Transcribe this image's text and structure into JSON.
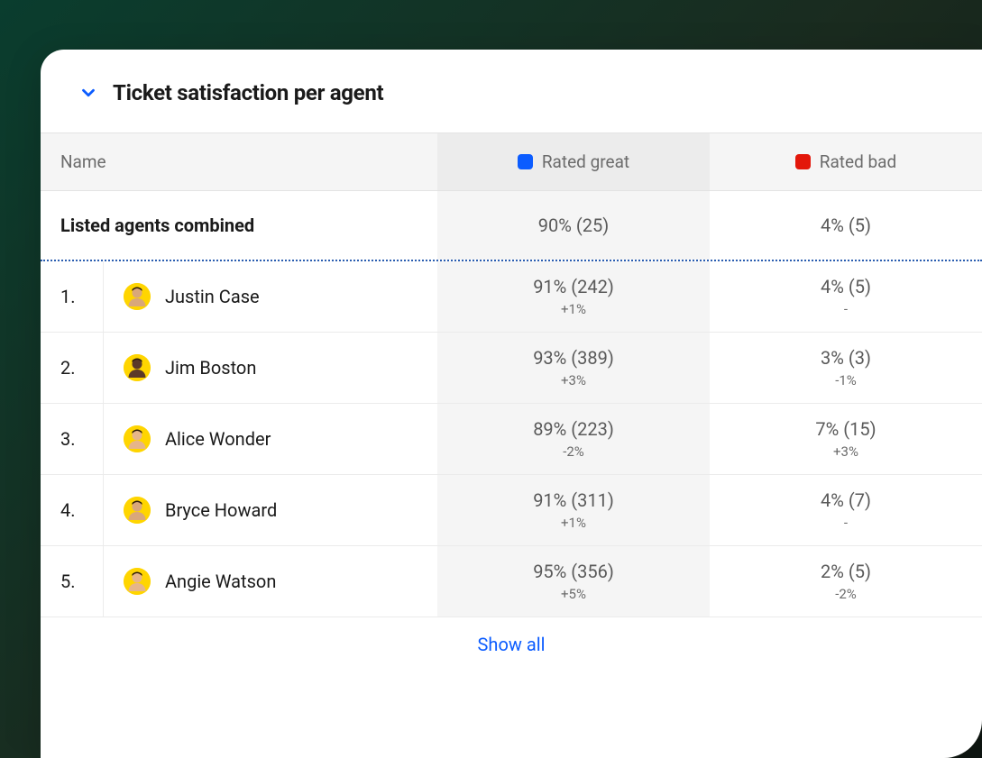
{
  "header": {
    "title": "Ticket satisfaction per agent"
  },
  "columns": {
    "name": "Name",
    "great": "Rated great",
    "bad": "Rated bad"
  },
  "combined": {
    "label": "Listed agents combined",
    "great": "90% (25)",
    "bad": "4% (5)"
  },
  "agents": [
    {
      "rank": "1.",
      "name": "Justin Case",
      "great_main": "91% (242)",
      "great_delta": "+1%",
      "bad_main": "4% (5)",
      "bad_delta": "-"
    },
    {
      "rank": "2.",
      "name": "Jim Boston",
      "great_main": "93% (389)",
      "great_delta": "+3%",
      "bad_main": "3% (3)",
      "bad_delta": "-1%"
    },
    {
      "rank": "3.",
      "name": "Alice Wonder",
      "great_main": "89% (223)",
      "great_delta": "-2%",
      "bad_main": "7% (15)",
      "bad_delta": "+3%"
    },
    {
      "rank": "4.",
      "name": "Bryce Howard",
      "great_main": "91% (311)",
      "great_delta": "+1%",
      "bad_main": "4% (7)",
      "bad_delta": "-"
    },
    {
      "rank": "5.",
      "name": "Angie Watson",
      "great_main": "95% (356)",
      "great_delta": "+5%",
      "bad_main": "2% (5)",
      "bad_delta": "-2%"
    }
  ],
  "footer": {
    "show_all": "Show all"
  },
  "avatar_skins": [
    "#d9a77a",
    "#5b3a29",
    "#e6b58a",
    "#d9a77a",
    "#e6b58a"
  ]
}
